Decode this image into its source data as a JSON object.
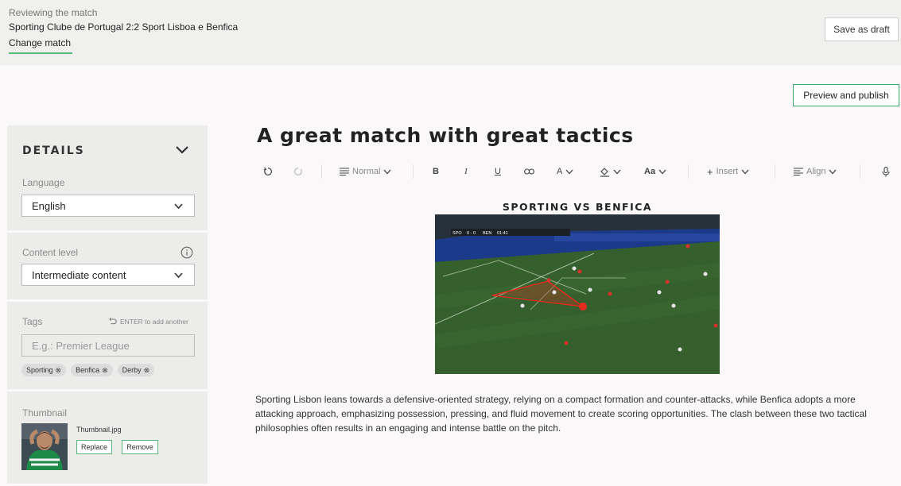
{
  "header": {
    "reviewing_label": "Reviewing the match",
    "match_name": "Sporting Clube de Portugal 2:2 Sport Lisboa e Benfica",
    "change_match_label": "Change match",
    "save_draft_label": "Save as draft",
    "preview_publish_label": "Preview and publish"
  },
  "sidebar": {
    "details_title": "DETAILS",
    "language": {
      "label": "Language",
      "value": "English"
    },
    "content_level": {
      "label": "Content level",
      "value": "Intermediate content"
    },
    "tags": {
      "label": "Tags",
      "hint": "ENTER to add another",
      "placeholder": "E.g.: Premier League",
      "items": [
        "Sporting",
        "Benfica",
        "Derby"
      ]
    },
    "thumbnail": {
      "label": "Thumbnail",
      "filename": "Thumbnail.jpg",
      "replace_label": "Replace",
      "remove_label": "Remove"
    }
  },
  "editor": {
    "title": "A great match with great tactics",
    "toolbar": {
      "paragraph_style": "Normal",
      "bold": "B",
      "italic": "I",
      "underline": "U",
      "font_color": "A",
      "text_size": "Aa",
      "insert_label": "Insert",
      "align_label": "Align"
    },
    "image_caption": "SPORTING VS BENFICA",
    "scoreboard": {
      "home": "SPO",
      "score": "0 - 0",
      "away": "BEN",
      "clock": "01:41"
    },
    "body": "Sporting Lisbon leans towards a defensive-oriented strategy, relying on a compact formation and counter-attacks, while Benfica adopts a more attacking approach, emphasizing possession, pressing, and fluid movement to create scoring opportunities. The clash between these two tactical philosophies often results in an engaging and intense battle on the pitch."
  },
  "colors": {
    "accent_green": "#3aa866",
    "top_bar_bg": "#f0f0ee",
    "panel_bg": "#ececeb",
    "pitch_green": "#2f5a2a",
    "tactic_red": "#e52a1f"
  }
}
